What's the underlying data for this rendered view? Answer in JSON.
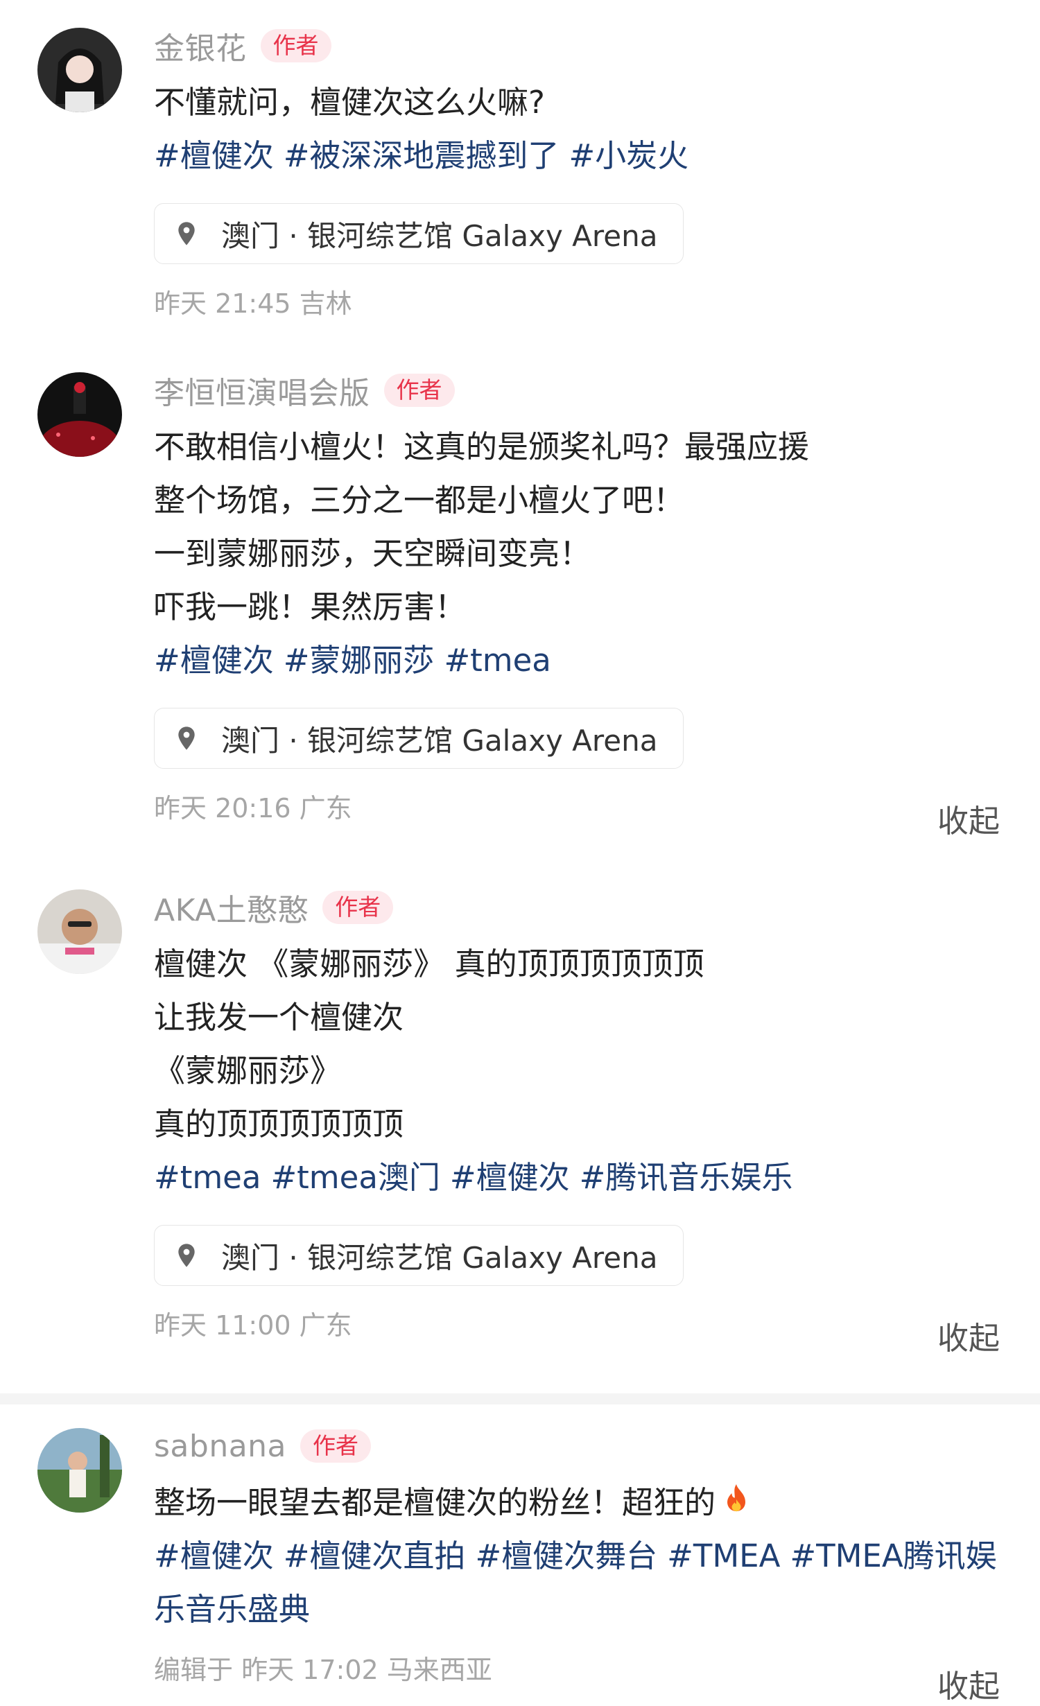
{
  "posts": [
    {
      "author": "金银花",
      "badge": "作者",
      "lines": [
        "不懂就问，檀健次这么火嘛?"
      ],
      "tags": [
        "#檀健次",
        "#被深深地震撼到了",
        "#小炭火"
      ],
      "location": "澳门 · 银河综艺馆 Galaxy Arena",
      "meta": "昨天 21:45 吉林"
    },
    {
      "author": "李恒恒演唱会版",
      "badge": "作者",
      "lines": [
        "不敢相信小檀火！这真的是颁奖礼吗？最强应援",
        "整个场馆，三分之一都是小檀火了吧！",
        "一到蒙娜丽莎，天空瞬间变亮！",
        "吓我一跳！果然厉害！"
      ],
      "tags": [
        "#檀健次",
        "#蒙娜丽莎",
        "#tmea"
      ],
      "location": "澳门 · 银河综艺馆 Galaxy Arena",
      "meta": "昨天 20:16 广东",
      "collapse": "收起"
    },
    {
      "author": "AKA土憨憨",
      "badge": "作者",
      "lines": [
        "檀健次 《蒙娜丽莎》 真的顶顶顶顶顶顶",
        "让我发一个檀健次",
        "《蒙娜丽莎》",
        "真的顶顶顶顶顶顶"
      ],
      "tags": [
        "#tmea",
        "#tmea澳门",
        "#檀健次",
        "#腾讯音乐娱乐"
      ],
      "location": "澳门 · 银河综艺馆 Galaxy Arena",
      "meta": "昨天 11:00 广东",
      "collapse": "收起"
    },
    {
      "author": "sabnana",
      "badge": "作者",
      "lines": [
        "整场一眼望去都是檀健次的粉丝！超狂的"
      ],
      "emoji": "fire-emoji",
      "tags": [
        "#檀健次",
        "#檀健次直拍",
        "#檀健次舞台",
        "#TMEA",
        "#TMEA腾讯娱乐音乐盛典"
      ],
      "meta": "编辑于 昨天 17:02 马来西亚",
      "collapse": "收起"
    }
  ],
  "colors": {
    "tag": "#1f3f73",
    "badge_bg": "#fde9ec",
    "badge_text": "#e8334a",
    "author": "#9a9a9a"
  }
}
